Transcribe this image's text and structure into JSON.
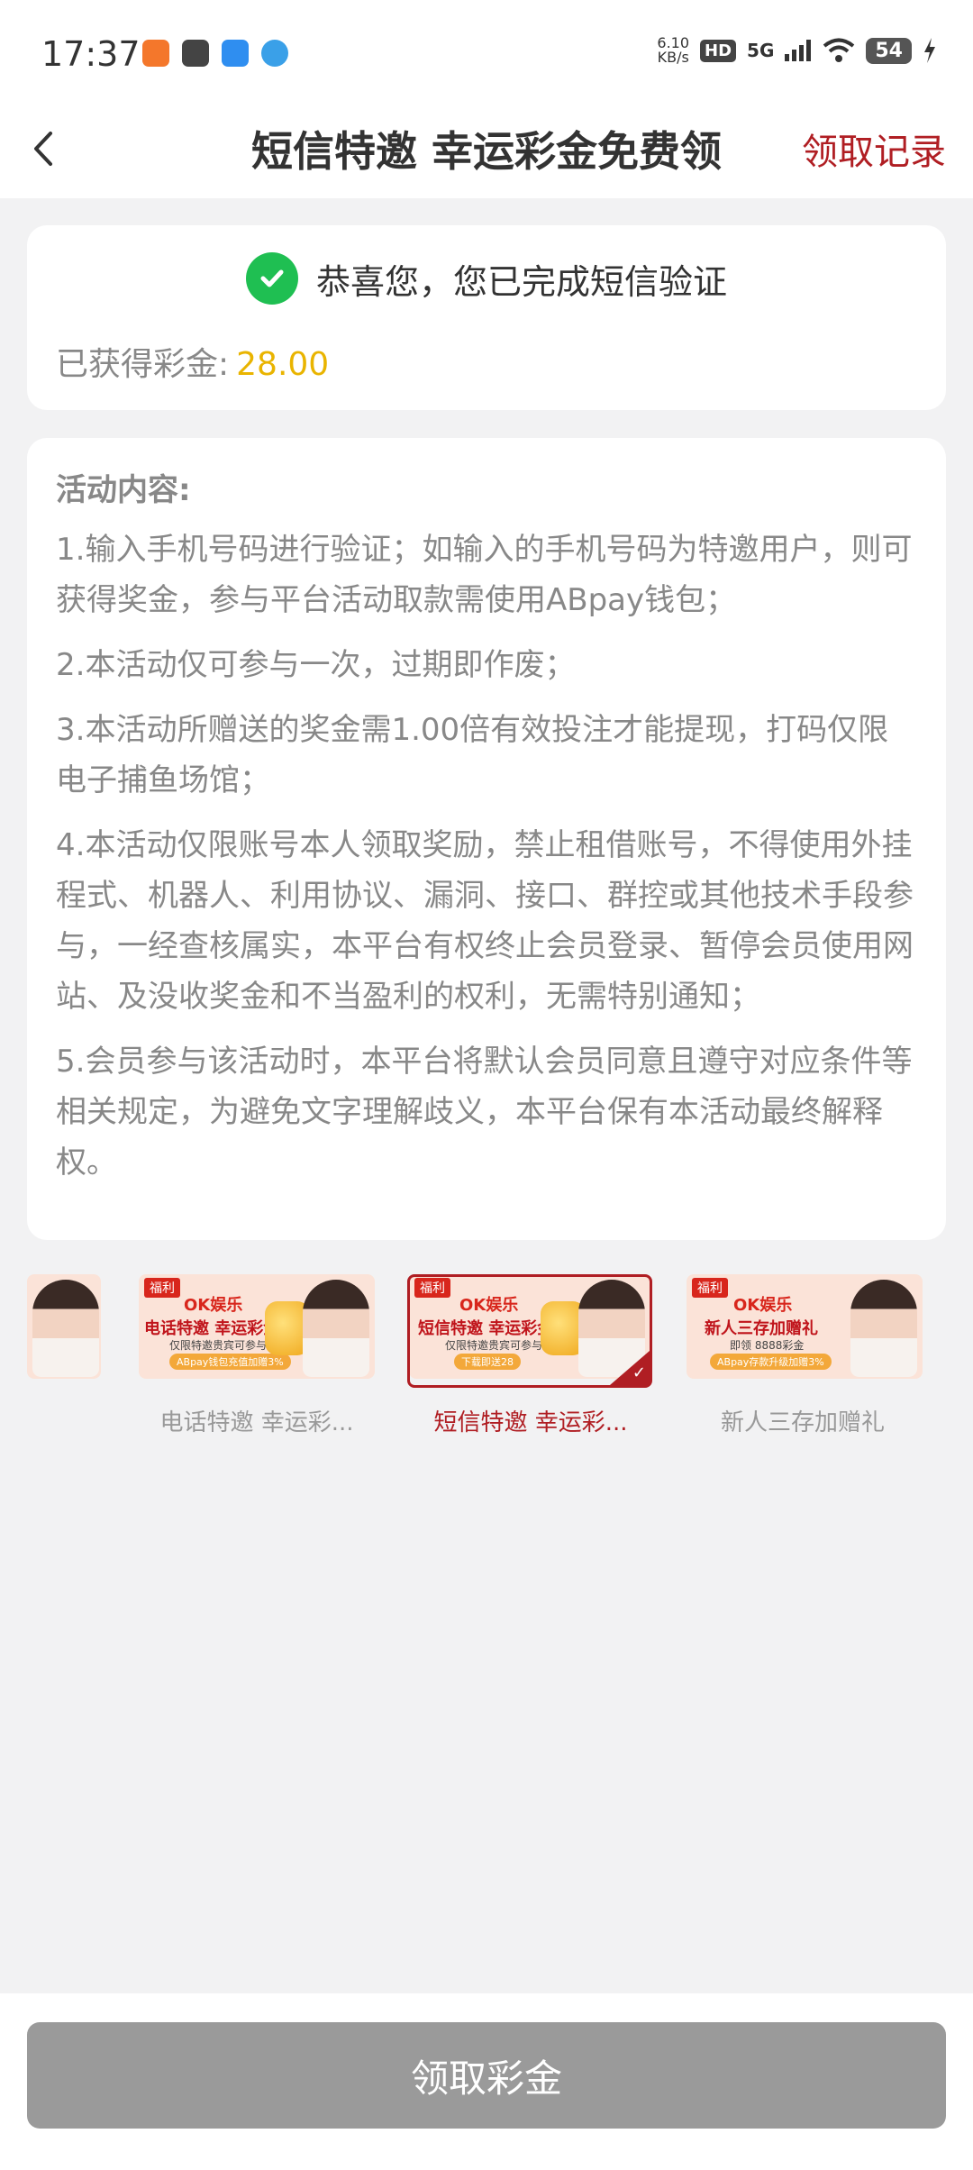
{
  "status_bar": {
    "time": "17:37",
    "net_speed_value": "6.10",
    "net_speed_unit": "KB/s",
    "hd": "HD",
    "network": "5G",
    "battery": "54",
    "app_icon_colors": [
      "#f4772b",
      "#444444",
      "#2f8ef0",
      "#3aa0e8"
    ]
  },
  "nav": {
    "title": "短信特邀 幸运彩金免费领",
    "record": "领取记录"
  },
  "status_card": {
    "message": "恭喜您，您已完成短信验证",
    "earned_label": "已获得彩金:",
    "earned_amount": "28.00"
  },
  "rules": {
    "title": "活动内容:",
    "items": [
      "1.输入手机号码进行验证；如输入的手机号码为特邀用户，则可获得奖金，参与平台活动取款需使用ABpay钱包；",
      "2.本活动仅可参与一次，过期即作废；",
      "3.本活动所赠送的奖金需1.00倍有效投注才能提现，打码仅限电子捕鱼场馆；",
      "4.本活动仅限账号本人领取奖励，禁止租借账号，不得使用外挂程式、机器人、利用协议、漏洞、接口、群控或其他技术手段参与，一经查核属实，本平台有权终止会员登录、暂停会员使用网站、及没收奖金和不当盈利的权利，无需特别通知；",
      "5.会员参与该活动时，本平台将默认会员同意且遵守对应条件等相关规定，为避免文字理解歧义，本平台保有本活动最终解释权。"
    ]
  },
  "carousel": {
    "items": [
      {
        "label": "电话特邀 幸运彩...",
        "tag": "福利",
        "logo": "OK娱乐",
        "headline": "电话特邀 幸运彩金免费领",
        "sub": "仅限特邀贵宾可参与",
        "pill": "ABpay钱包充值加赠3%"
      },
      {
        "label": "短信特邀 幸运彩...",
        "tag": "福利",
        "logo": "OK娱乐",
        "headline": "短信特邀 幸运彩金免费领",
        "sub": "仅限特邀贵宾可参与",
        "pill": "下载即送28",
        "selected": true
      },
      {
        "label": "新人三存加赠礼",
        "tag": "福利",
        "logo": "OK娱乐",
        "headline": "新人三存加赠礼",
        "sub": "即领 8888彩金",
        "pill": "ABpay存款升级加赠3%"
      }
    ]
  },
  "bottom": {
    "claim_button": "领取彩金"
  }
}
